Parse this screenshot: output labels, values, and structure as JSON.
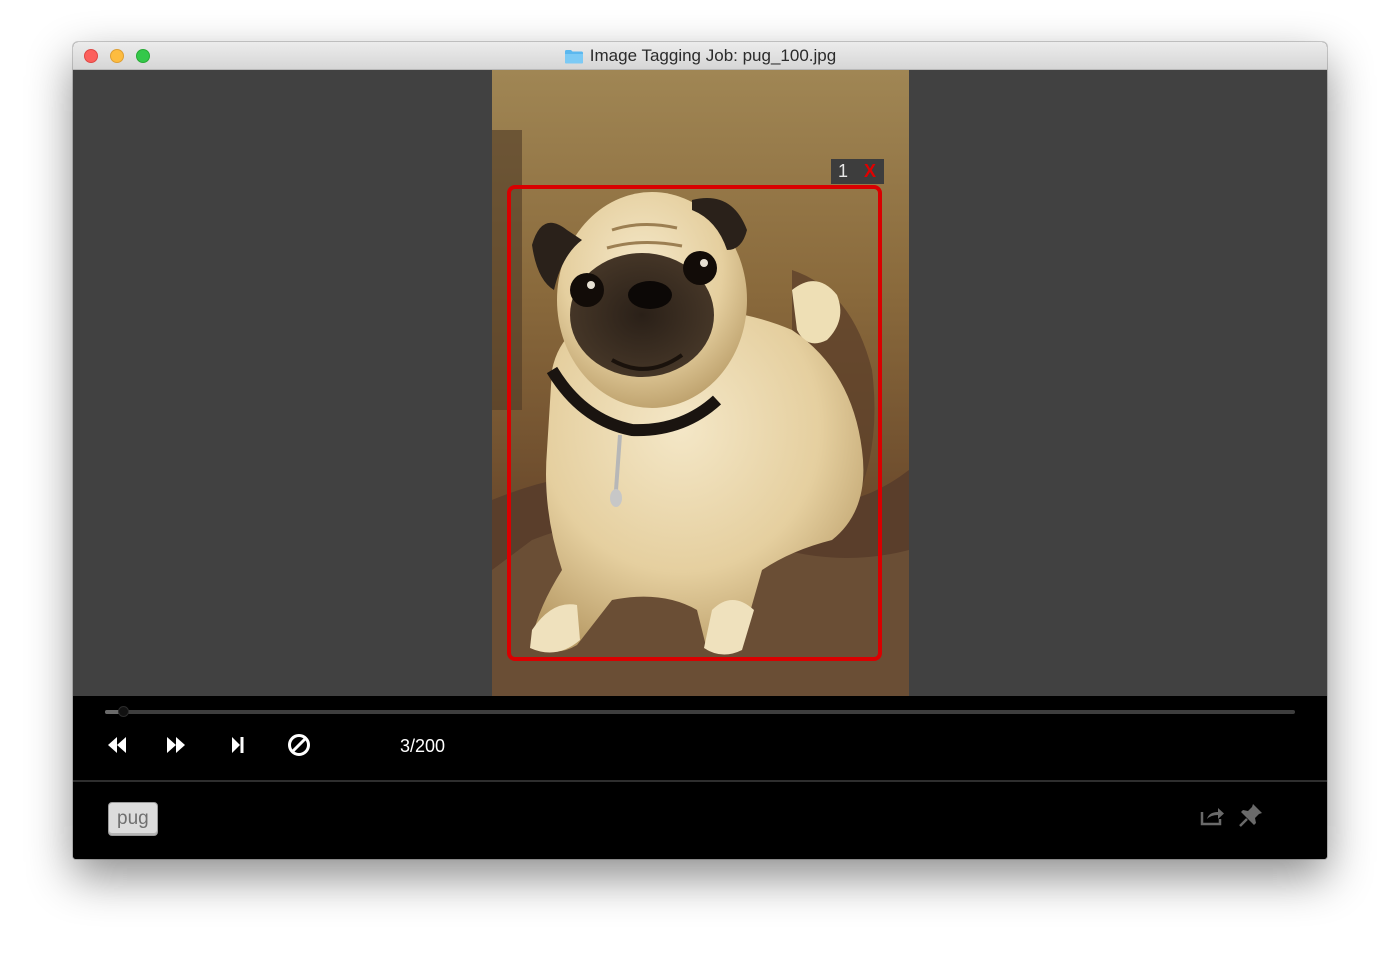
{
  "window": {
    "title": "Image Tagging Job: pug_100.jpg",
    "title_icon": "folder-icon"
  },
  "image": {
    "filename": "pug_100.jpg",
    "subject": "pug"
  },
  "region": {
    "index": "1",
    "delete_label": "X",
    "color": "#d90000"
  },
  "playback": {
    "progress_fraction": 0.015,
    "counter": "3/200",
    "buttons": [
      "rewind-icon",
      "fast-forward-icon",
      "skip-to-end-icon",
      "no-entry-icon"
    ]
  },
  "tags": [
    {
      "label": "pug"
    }
  ],
  "bottom_icons": [
    "export-icon",
    "pin-icon"
  ],
  "colors": {
    "stage_background": "#414141",
    "toolbar_background": "#000000",
    "counter_text": "#ffffff"
  }
}
